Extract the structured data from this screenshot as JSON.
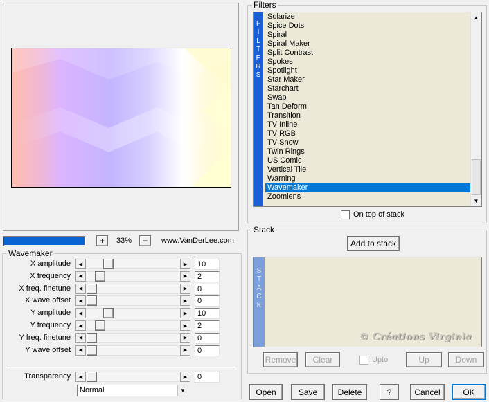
{
  "preview": {
    "zoom_in": "+",
    "zoom_level": "33%",
    "zoom_out": "−",
    "website": "www.VanDerLee.com",
    "progress": 1.0
  },
  "filters": {
    "title": "Filters",
    "side_label": [
      "F",
      "I",
      "L",
      "T",
      "E",
      "R",
      "S"
    ],
    "items": [
      "Solarize",
      "Spice Dots",
      "Spiral",
      "Spiral Maker",
      "Split Contrast",
      "Spokes",
      "Spotlight",
      "Star Maker",
      "Starchart",
      "Swap",
      "Tan Deform",
      "Transition",
      "TV Inline",
      "TV RGB",
      "TV Snow",
      "Twin Rings",
      "US Comic",
      "Vertical Tile",
      "Warning",
      "Wavemaker",
      "Zoomlens"
    ],
    "selected": "Wavemaker",
    "on_top_label": "On top of stack",
    "on_top_checked": false
  },
  "params": {
    "title": "Wavemaker",
    "rows": [
      {
        "label": "X amplitude",
        "value": "10",
        "pos": 0.2
      },
      {
        "label": "X frequency",
        "value": "2",
        "pos": 0.1
      },
      {
        "label": "X freq. finetune",
        "value": "0",
        "pos": 0.0
      },
      {
        "label": "X wave offset",
        "value": "0",
        "pos": 0.0
      },
      {
        "label": "Y amplitude",
        "value": "10",
        "pos": 0.2
      },
      {
        "label": "Y frequency",
        "value": "2",
        "pos": 0.1
      },
      {
        "label": "Y freq. finetune",
        "value": "0",
        "pos": 0.0
      },
      {
        "label": "Y wave offset",
        "value": "0",
        "pos": 0.0
      }
    ],
    "transparency_label": "Transparency",
    "transparency_value": "0",
    "blend_mode": "Normal"
  },
  "stack": {
    "title": "Stack",
    "add_button": "Add to stack",
    "side_label": [
      "S",
      "T",
      "A",
      "C",
      "K"
    ],
    "watermark": "© Créations Virginia",
    "remove": "Remove",
    "clear": "Clear",
    "upto": "Upto",
    "up": "Up",
    "down": "Down"
  },
  "footer": {
    "open": "Open",
    "save": "Save",
    "delete": "Delete",
    "help": "?",
    "cancel": "Cancel",
    "ok": "OK"
  }
}
